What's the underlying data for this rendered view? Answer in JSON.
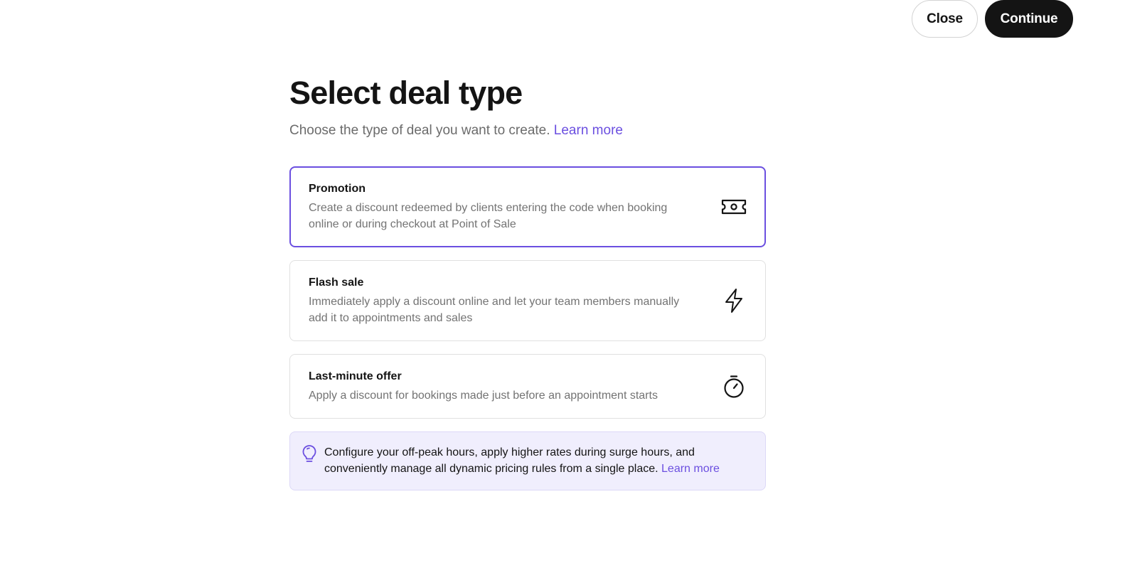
{
  "header": {
    "close_label": "Close",
    "continue_label": "Continue"
  },
  "page": {
    "title": "Select deal type",
    "subtitle": "Choose the type of deal you want to create.",
    "subtitle_link": "Learn more"
  },
  "deal_types": [
    {
      "title": "Promotion",
      "description": "Create a discount redeemed by clients entering the code when booking online or during checkout at Point of Sale",
      "icon": "ticket-icon",
      "selected": true
    },
    {
      "title": "Flash sale",
      "description": "Immediately apply a discount online and let your team members manually add it to appointments and sales",
      "icon": "lightning-icon",
      "selected": false
    },
    {
      "title": "Last-minute offer",
      "description": "Apply a discount for bookings made just before an appointment starts",
      "icon": "stopwatch-icon",
      "selected": false
    }
  ],
  "tip": {
    "icon": "lightbulb-icon",
    "text": "Configure your off-peak hours, apply higher rates during surge hours, and conveniently manage all dynamic pricing rules from a single place.",
    "link": "Learn more"
  },
  "colors": {
    "accent": "#6b4fe0",
    "primary_button": "#141414",
    "tip_background": "#f0eefd"
  }
}
